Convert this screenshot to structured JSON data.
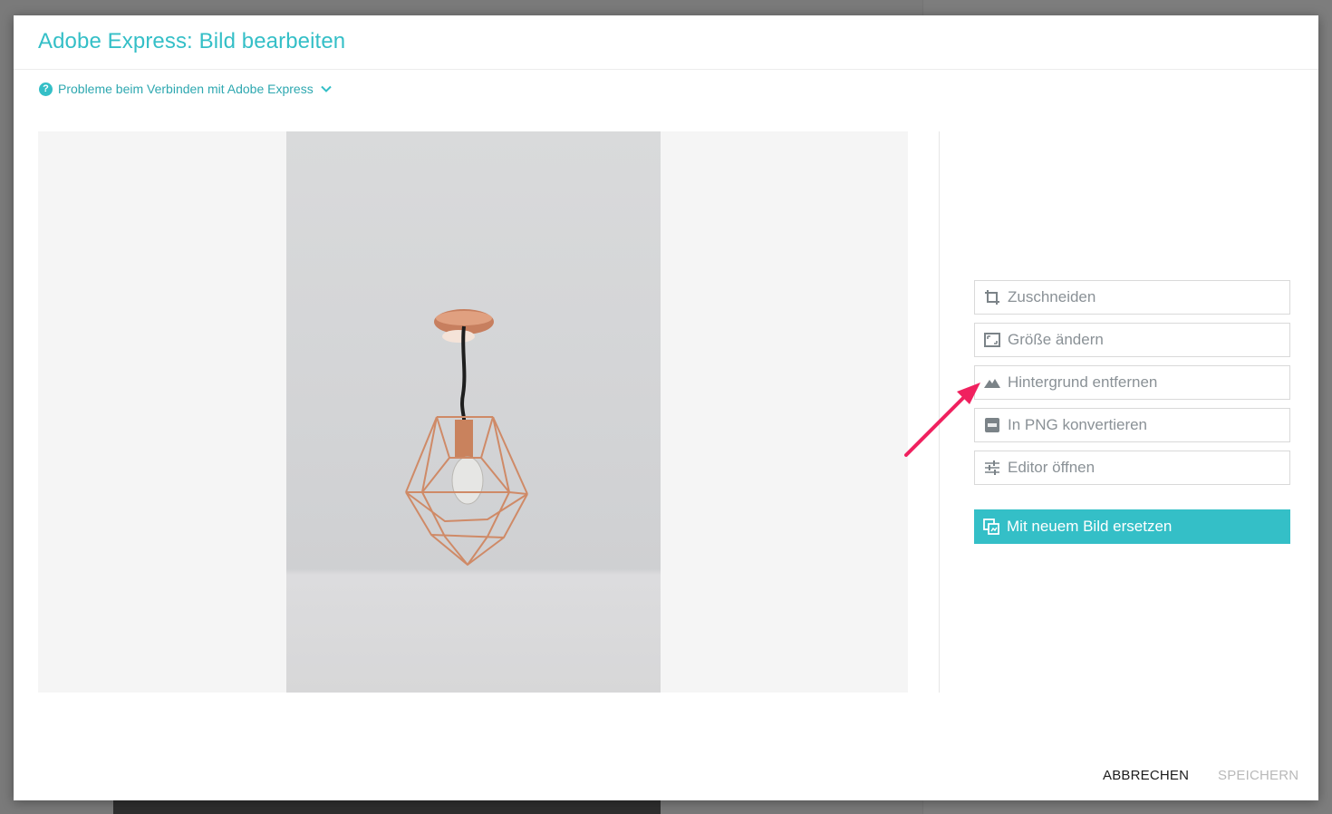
{
  "dialog": {
    "title": "Adobe Express: Bild bearbeiten",
    "help_link": "Probleme beim Verbinden mit Adobe Express"
  },
  "image": {
    "description_icon": "pendant-lamp-photo"
  },
  "actions": [
    {
      "label": "Zuschneiden",
      "icon": "crop-icon"
    },
    {
      "label": "Größe ändern",
      "icon": "resize-icon"
    },
    {
      "label": "Hintergrund entfernen",
      "icon": "mountain-icon"
    },
    {
      "label": "In PNG konvertieren",
      "icon": "png-icon"
    },
    {
      "label": "Editor öffnen",
      "icon": "sliders-icon"
    }
  ],
  "primary_action": {
    "label": "Mit neuem Bild ersetzen",
    "icon": "replace-image-icon"
  },
  "footer": {
    "cancel_label": "ABBRECHEN",
    "save_label": "SPEICHERN"
  },
  "colors": {
    "accent": "#34bfc7",
    "annotation_arrow": "#f0215f",
    "muted_text": "#8a9196"
  }
}
